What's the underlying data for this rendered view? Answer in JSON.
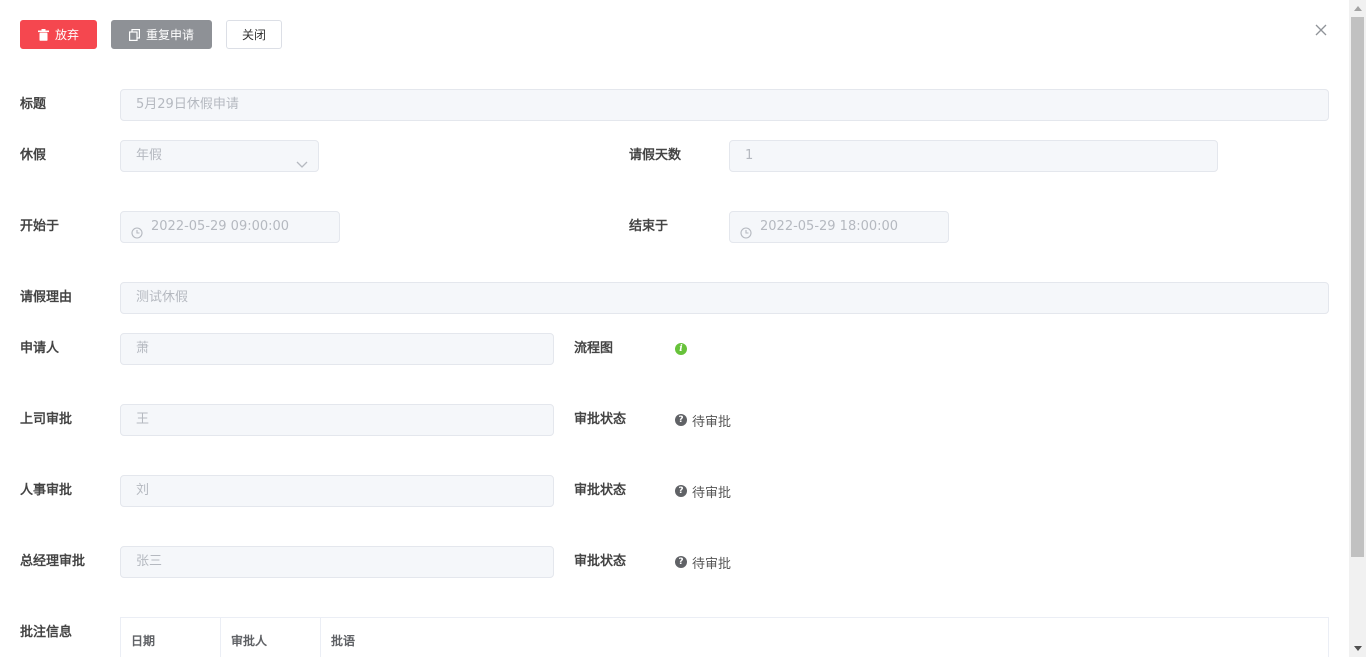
{
  "toolbar": {
    "abandon_label": "放弃",
    "reapply_label": "重复申请",
    "close_label": "关闭"
  },
  "form": {
    "title": {
      "label": "标题",
      "value": "5月29日休假申请"
    },
    "leave_type": {
      "label": "休假",
      "value": "年假"
    },
    "days": {
      "label": "请假天数",
      "value": "1"
    },
    "start": {
      "label": "开始于",
      "value": "2022-05-29 09:00:00"
    },
    "end": {
      "label": "结束于",
      "value": "2022-05-29 18:00:00"
    },
    "reason": {
      "label": "请假理由",
      "value": "测试休假"
    },
    "applicant": {
      "label": "申请人",
      "value": "萧"
    },
    "flowchart": {
      "label": "流程图"
    },
    "supervisor": {
      "label": "上司审批",
      "value": "王",
      "status_label": "审批状态",
      "status": "待审批"
    },
    "hr": {
      "label": "人事审批",
      "value": "刘",
      "status_label": "审批状态",
      "status": "待审批"
    },
    "gm": {
      "label": "总经理审批",
      "value": "张三",
      "status_label": "审批状态",
      "status": "待审批"
    },
    "comments": {
      "label": "批注信息",
      "columns": [
        "日期",
        "审批人",
        "批语"
      ]
    }
  },
  "colors": {
    "danger": "#f5474f",
    "gray": "#8e9196",
    "info_green": "#67c23a"
  }
}
